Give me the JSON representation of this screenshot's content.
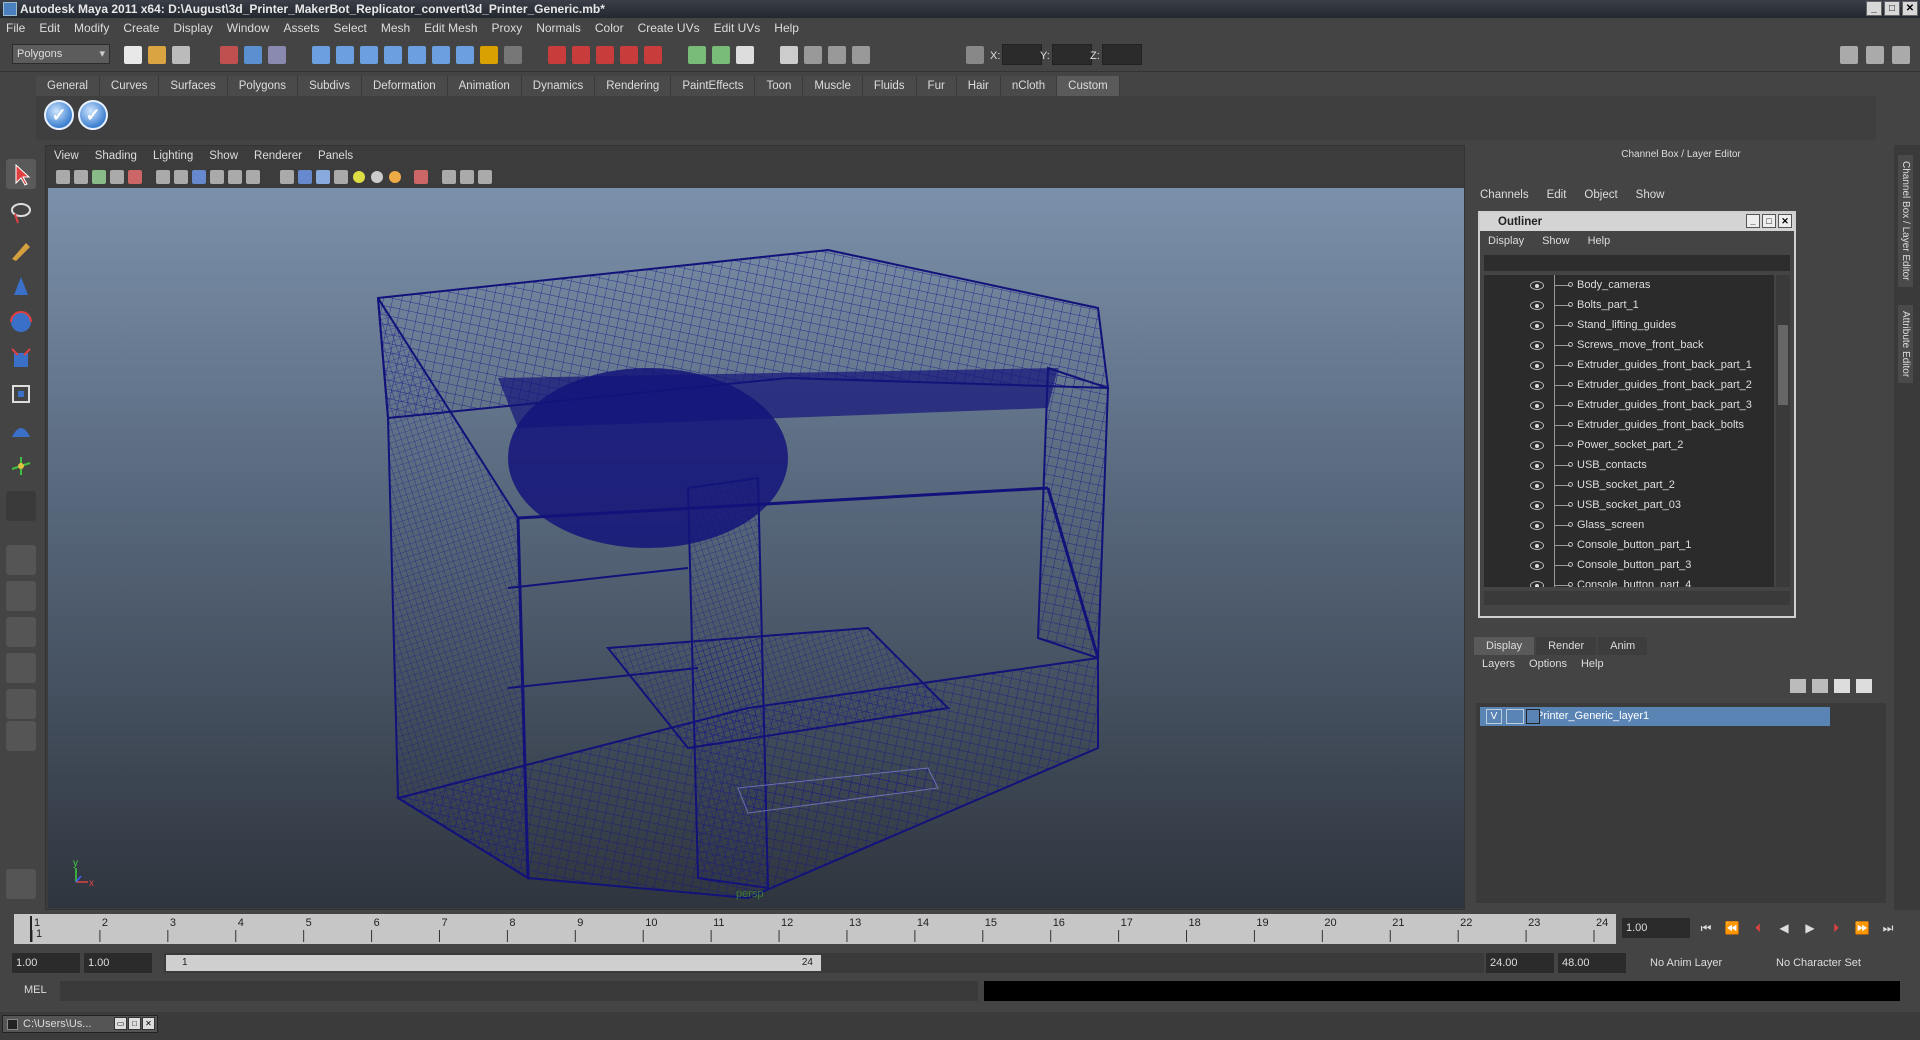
{
  "window": {
    "title": "Autodesk Maya 2011 x64: D:\\August\\3d_Printer_MakerBot_Replicator_convert\\3d_Printer_Generic.mb*",
    "min": "_",
    "max": "□",
    "close": "✕"
  },
  "menubar": [
    "File",
    "Edit",
    "Modify",
    "Create",
    "Display",
    "Window",
    "Assets",
    "Select",
    "Mesh",
    "Edit Mesh",
    "Proxy",
    "Normals",
    "Color",
    "Create UVs",
    "Edit UVs",
    "Help"
  ],
  "statusline": {
    "mode": "Polygons",
    "x_label": "X:",
    "y_label": "Y:",
    "z_label": "Z:"
  },
  "shelf": {
    "tabs": [
      "General",
      "Curves",
      "Surfaces",
      "Polygons",
      "Subdivs",
      "Deformation",
      "Animation",
      "Dynamics",
      "Rendering",
      "PaintEffects",
      "Toon",
      "Muscle",
      "Fluids",
      "Fur",
      "Hair",
      "nCloth",
      "Custom"
    ],
    "active_tab": "Custom"
  },
  "viewport": {
    "menu": [
      "View",
      "Shading",
      "Lighting",
      "Show",
      "Renderer",
      "Panels"
    ],
    "camera_label": "persp",
    "axis_y": "y",
    "axis_x": "x",
    "wire_color": "#1a1a8a"
  },
  "channelbox": {
    "title": "Channel Box / Layer Editor",
    "menu": [
      "Channels",
      "Edit",
      "Object",
      "Show"
    ]
  },
  "outliner": {
    "title": "Outliner",
    "menu": [
      "Display",
      "Show",
      "Help"
    ],
    "items": [
      "Body_cameras",
      "Bolts_part_1",
      "Stand_lifting_guides",
      "Screws_move_front_back",
      "Extruder_guides_front_back_part_1",
      "Extruder_guides_front_back_part_2",
      "Extruder_guides_front_back_part_3",
      "Extruder_guides_front_back_bolts",
      "Power_socket_part_2",
      "USB_contacts",
      "USB_socket_part_2",
      "USB_socket_part_03",
      "Glass_screen",
      "Console_button_part_1",
      "Console_button_part_3",
      "Console_button_part_4"
    ]
  },
  "layers": {
    "tabs": [
      "Display",
      "Render",
      "Anim"
    ],
    "active_tab": "Display",
    "menu": [
      "Layers",
      "Options",
      "Help"
    ],
    "layer_name": "Printer_Generic_layer1",
    "visibility_flag": "V"
  },
  "side_tabs": [
    "Channel Box / Layer Editor",
    "Attribute Editor"
  ],
  "timeline": {
    "ticks": [
      "1",
      "2",
      "3",
      "4",
      "5",
      "6",
      "7",
      "8",
      "9",
      "10",
      "11",
      "12",
      "13",
      "14",
      "15",
      "16",
      "17",
      "18",
      "19",
      "20",
      "21",
      "22",
      "23",
      "24"
    ],
    "current_frame_label": "1",
    "current_frame_field": "1.00"
  },
  "range": {
    "start_time": "1.00",
    "playback_start": "1.00",
    "handle_start": "1",
    "handle_end": "24",
    "playback_end": "24.00",
    "end_time": "48.00",
    "anim_layer": "No Anim Layer",
    "character_set": "No Character Set"
  },
  "cmdline": {
    "label": "MEL"
  },
  "taskbar": {
    "item": "C:\\Users\\Us..."
  }
}
